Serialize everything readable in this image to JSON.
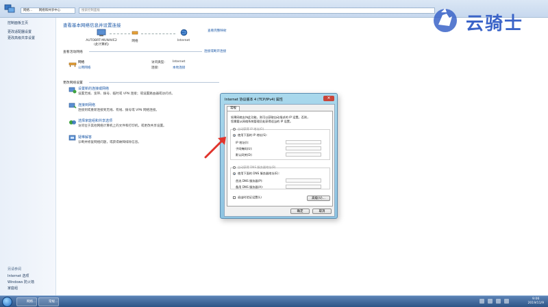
{
  "window": {
    "address_label": "网络...",
    "address_path": "网络和共享中心",
    "search_placeholder": "搜索控制面板"
  },
  "logo": {
    "text": "云骑士"
  },
  "left_pane": {
    "items": [
      "控制面板主页",
      "更改适配器设置",
      "更改高级共享设置"
    ],
    "see_also_title": "另请参阅",
    "see_also": [
      "Internet 选项",
      "Windows 防火墙",
      "家庭组"
    ]
  },
  "main": {
    "title": "查看基本网络信息并设置连接",
    "full_map_link": "查看完整映射",
    "map": {
      "computer": "AUTOBRT-MUNAVE2",
      "computer_sub": "(此计算机)",
      "network": "网络",
      "internet": "Internet"
    },
    "active_title": "查看活动网络",
    "connect_link": "连接或断开连接",
    "network_name": "网络",
    "network_type": "公用网络",
    "access_type_label": "访问类型:",
    "access_type_value": "Internet",
    "connections_label": "连接:",
    "connections_value": "本地连接",
    "change_title": "更改网络设置",
    "tasks": [
      {
        "title": "设置新的连接或网络",
        "desc": "设置无线、宽带、拨号、临时或 VPN 连接；或设置路由器或访问点。"
      },
      {
        "title": "连接到网络",
        "desc": "连接到或重新连接到无线、有线、拨号或 VPN 网络连接。"
      },
      {
        "title": "选择家庭组和共享选项",
        "desc": "访问位于其他网络计算机上的文件和打印机，或更改共享设置。"
      },
      {
        "title": "疑难解答",
        "desc": "诊断并修复网络问题，或获得故障排除信息。"
      }
    ]
  },
  "dialog": {
    "title": "Internet 协议版本 4 (TCP/IPv4) 属性",
    "tab": "常规",
    "description_line1": "如果网络支持此功能，则可以获取自动指派的 IP 设置。否则，",
    "description_line2": "您需要从网络系统管理员处获得适当的 IP 设置。",
    "auto_ip": "自动获得 IP 地址(O)",
    "manual_ip": "使用下面的 IP 地址(S):",
    "ip_address": "IP 地址(I):",
    "subnet_mask": "子网掩码(U):",
    "gateway": "默认网关(D):",
    "auto_dns": "自动获得 DNS 服务器地址(B)",
    "manual_dns": "使用下面的 DNS 服务器地址(E):",
    "preferred_dns": "首选 DNS 服务器(P):",
    "alternate_dns": "备用 DNS 服务器(A):",
    "validate": "退出时验证设置(L)",
    "advanced_button": "高级(V)...",
    "ok_button": "确定",
    "cancel_button": "取消"
  },
  "taskbar": {
    "btn1": "网络...",
    "btn2": "常规...",
    "time": "9:06",
    "date": "2019/11/9"
  }
}
